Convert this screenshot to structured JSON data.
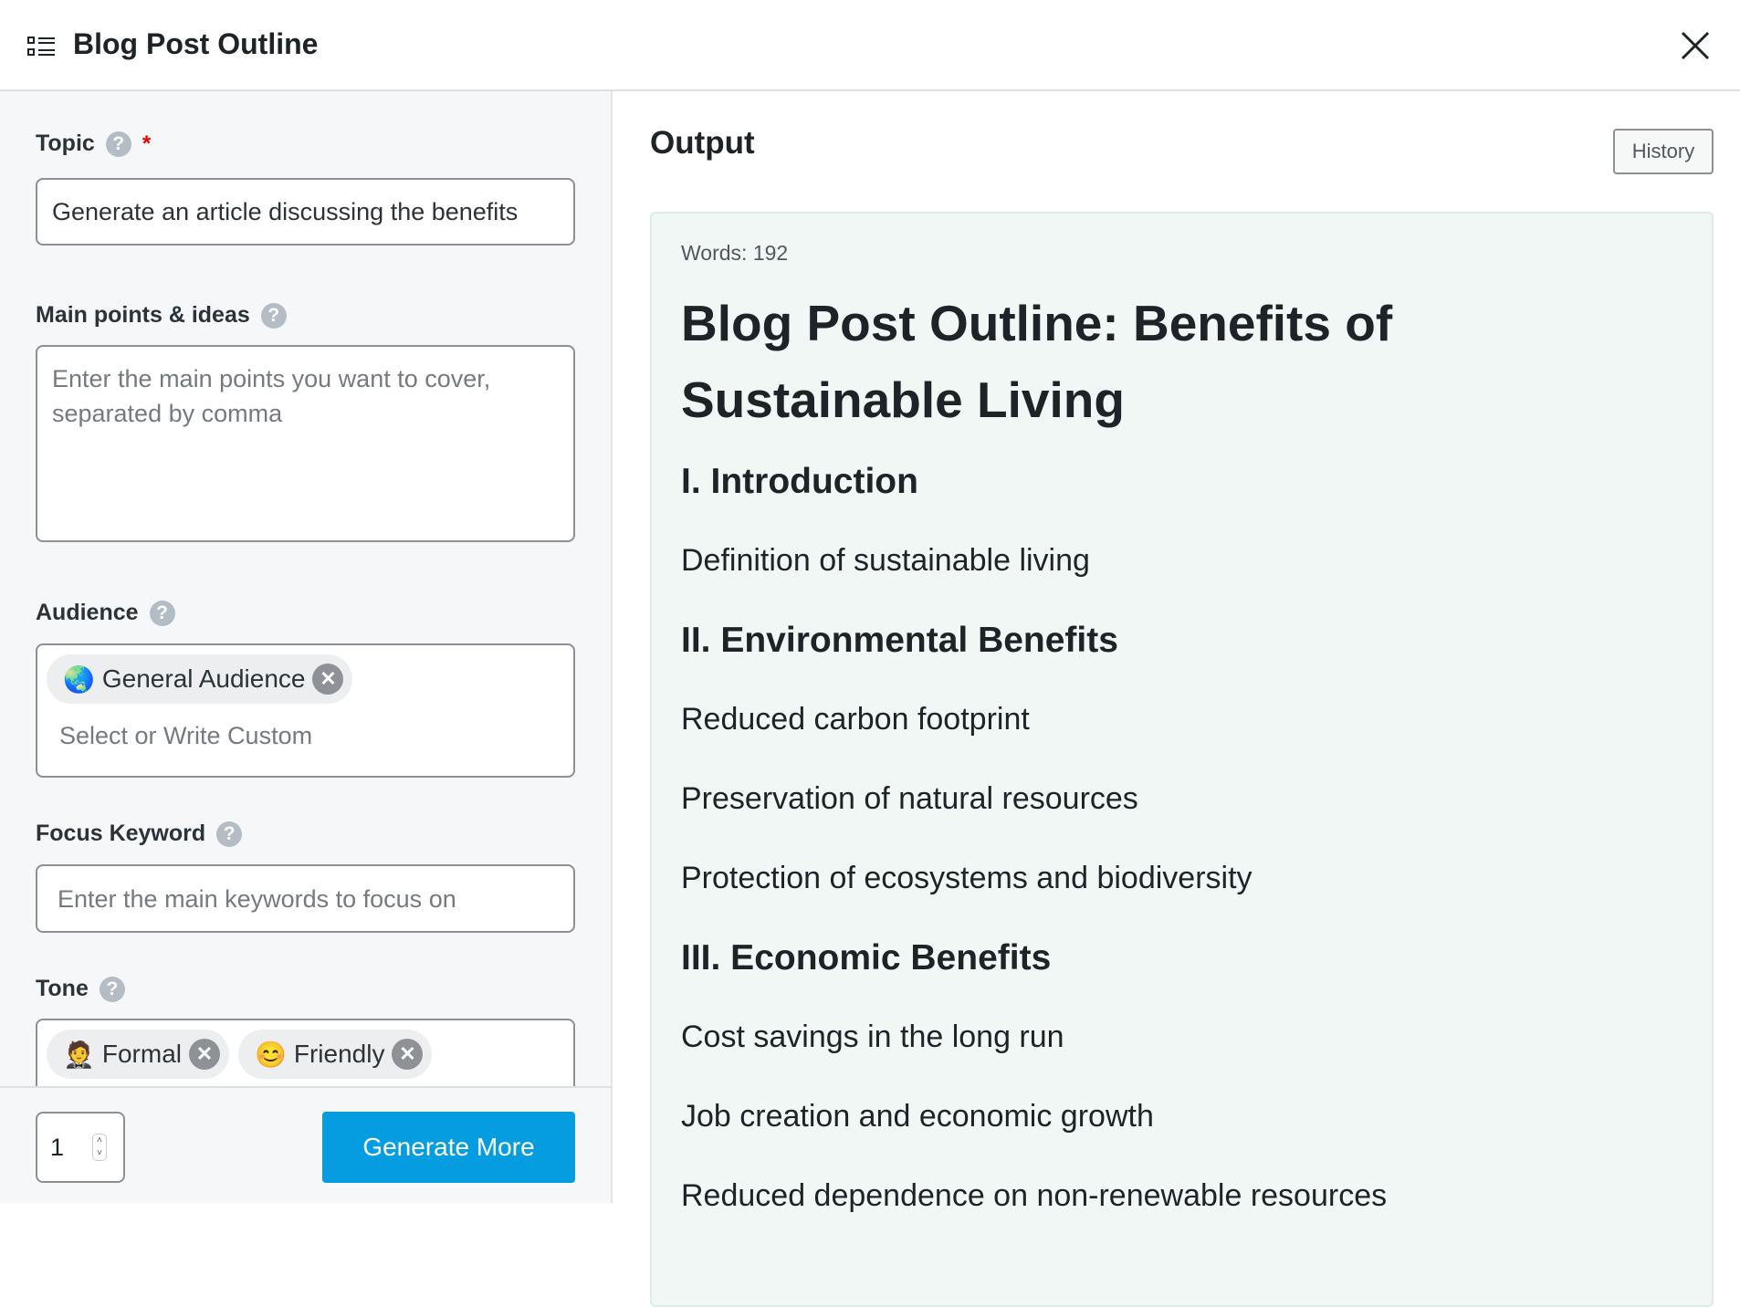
{
  "header": {
    "title": "Blog Post Outline",
    "icon": "list-icon",
    "close_icon": "close-icon"
  },
  "form": {
    "topic": {
      "label": "Topic",
      "required_mark": "*",
      "value": "Generate an article discussing the benefits"
    },
    "main_points": {
      "label": "Main points & ideas",
      "placeholder": "Enter the main points you want to cover, separated by comma"
    },
    "audience": {
      "label": "Audience",
      "chips": [
        {
          "emoji": "🌏",
          "label": "General Audience"
        }
      ],
      "placeholder": "Select or Write Custom"
    },
    "focus_keyword": {
      "label": "Focus Keyword",
      "placeholder": "Enter the main keywords to focus on"
    },
    "tone": {
      "label": "Tone",
      "chips": [
        {
          "emoji": "🤵",
          "label": "Formal"
        },
        {
          "emoji": "😊",
          "label": "Friendly"
        }
      ]
    }
  },
  "footer": {
    "count": "1",
    "generate_label": "Generate More"
  },
  "output": {
    "title": "Output",
    "history_label": "History",
    "words": "Words: 192",
    "heading": "Blog Post Outline: Benefits of Sustainable Living",
    "items": [
      {
        "text": "I. Introduction",
        "type": "h2"
      },
      {
        "text": "Definition of sustainable living",
        "type": "p"
      },
      {
        "text": "II. Environmental Benefits",
        "type": "h2"
      },
      {
        "text": "Reduced carbon footprint",
        "type": "p"
      },
      {
        "text": "Preservation of natural resources",
        "type": "p"
      },
      {
        "text": "Protection of ecosystems and biodiversity",
        "type": "p"
      },
      {
        "text": "III. Economic Benefits",
        "type": "h2"
      },
      {
        "text": "Cost savings in the long run",
        "type": "p"
      },
      {
        "text": "Job creation and economic growth",
        "type": "p"
      },
      {
        "text": "Reduced dependence on non-renewable resources",
        "type": "p"
      }
    ]
  }
}
